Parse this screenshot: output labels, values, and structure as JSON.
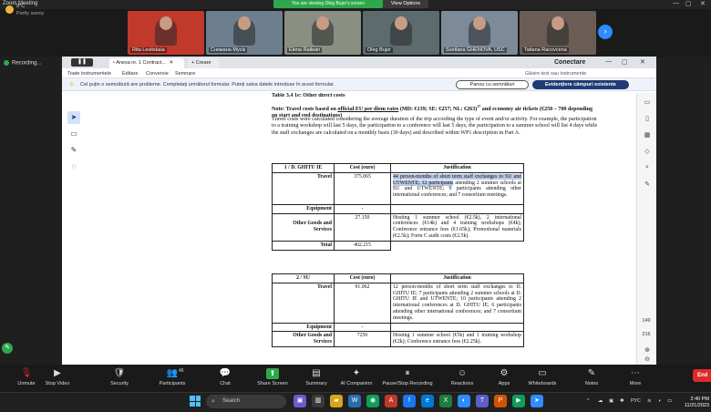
{
  "zoom": {
    "window_title": "Zoom Meeting",
    "viewing_banner": "You are viewing Oleg Bujor's screen",
    "view_options": "View Options",
    "recording": "Recording...",
    "participants": [
      {
        "name": "Rita Levitskaia",
        "bg": "#c0392b"
      },
      {
        "name": "Cнежана Мусiк",
        "bg": "#6d7f8f"
      },
      {
        "name": "Elena Railean",
        "bg": "#8a8f84"
      },
      {
        "name": "Oleg Bujor",
        "bg": "#5b6b6e"
      },
      {
        "name": "Svetlana GHENOVA, USC",
        "bg": "#7d8a9a"
      },
      {
        "name": "Tatiana Racovcena",
        "bg": "#6b5d55"
      }
    ],
    "controls": [
      {
        "key": "unmute",
        "label": "Unmute",
        "icon": "🎙"
      },
      {
        "key": "video",
        "label": "Stop Video",
        "icon": "▶"
      },
      {
        "key": "security",
        "label": "Security",
        "icon": "🛡"
      },
      {
        "key": "participants",
        "label": "Participants",
        "icon": "👥"
      },
      {
        "key": "chat",
        "label": "Chat",
        "icon": "💬"
      },
      {
        "key": "share",
        "label": "Share Screen",
        "icon": "⬆"
      },
      {
        "key": "summary",
        "label": "Summary",
        "icon": "▤"
      },
      {
        "key": "companion",
        "label": "AI Companion",
        "icon": "✦"
      },
      {
        "key": "record",
        "label": "Pause/Stop Recording",
        "icon": "⏸"
      },
      {
        "key": "reactions",
        "label": "Reactions",
        "icon": "☺"
      },
      {
        "key": "apps",
        "label": "Apps",
        "icon": "⚙"
      },
      {
        "key": "whiteboards",
        "label": "Whiteboards",
        "icon": "▭"
      },
      {
        "key": "notes",
        "label": "Notes",
        "icon": "✎"
      },
      {
        "key": "more",
        "label": "More",
        "icon": "⋯"
      }
    ],
    "participant_count": "45",
    "end_label": "End"
  },
  "browser": {
    "tab_active": "Anexa nr. 1 Contract...",
    "tab_new": "Creare",
    "conectare": "Conectare",
    "menu": [
      "Toate instrumentele",
      "Editare",
      "Conversie",
      "Semnare"
    ],
    "search_tools": "Găsire text sau instrumente",
    "notice": "Cel puțin o semnătură are probleme. Completați următorul formular. Puteți salva datele introduse în acest formular.",
    "btn_sign": "Panou cu semnături",
    "btn_fields": "Evidențiere câmpuri existente",
    "page_current": "149",
    "page_total": "216"
  },
  "doc": {
    "heading": "Table 3.4 1e: Other direct costs",
    "note_pre": "Note: Travel costs based on ",
    "note_u": "official EU per diem rates",
    "note_post": " (MD: €139; SE: €257; NL: €263)",
    "note_sup": "17",
    "note_tail": " and economy air tickets (€250 – 700 depending on start and end destinations)",
    "para": "Travel costs were calculated considering the average duration of the trip according the type of event and/or activity. For example, the participation to a training workshop will last 5 days, the participation to a conference will last 5 days, the participation to a summer school will list 4 days while the staff exchanges are calculated on a monthly basis (30 days) and described within WP1 description in Part A.",
    "table1": {
      "h1": "1 / D. GHITU IE",
      "h2": "Cost (euro)",
      "h3": "Justification",
      "travel": "Travel",
      "travel_cost": "375.065",
      "travel_just_hl": "44 person-months of short term staff exchanges to SU and UTWENTE; 12 participants",
      "travel_just": " attending 2 summer schools at SU and UTWENTE; 9 participants attending other international conferences; and 7 consortium meetings.",
      "equip": "Equipment",
      "equip_cost": "-",
      "ogs": "Other Goods and Services",
      "ogs_cost": "27.150",
      "ogs_just": "Hosting 1 summer school (€2.5k), 2 international conferences (€14k) and 4 training workshops (€4k); Conference entrance fees (€1.65k); Promotional materials (€2.5k); Form C audit costs (€2.5k).",
      "total": "Total",
      "total_cost": "402.215"
    },
    "table2": {
      "h1": "2 / SU",
      "h2": "Cost (euro)",
      "h3": "Justification",
      "travel": "Travel",
      "travel_cost": "91.062",
      "travel_just": "12 person-months of short term staff exchanges to D. GHITU IE; 7 participants attending 2 summer schools at D. GHITU IE and UTWENTE; 10 participants attending 2 international conferences at D. GHITU IE; 6 participants attending other international conferences; and 7 consortium meetings.",
      "equip": "Equipment",
      "equip_cost": "-",
      "ogs": "Other Goods and Services",
      "ogs_cost": "7250",
      "ogs_just": "Hosting 1 summer school (€5k) and 1 training workshop (€2k); Conference entrance fees (€2.25k)."
    }
  },
  "taskbar": {
    "temp": "9°C",
    "weather": "Partly sunny",
    "search": "Search",
    "lang": "РУС",
    "time": "2:40 PM",
    "date": "11/21/2023"
  }
}
